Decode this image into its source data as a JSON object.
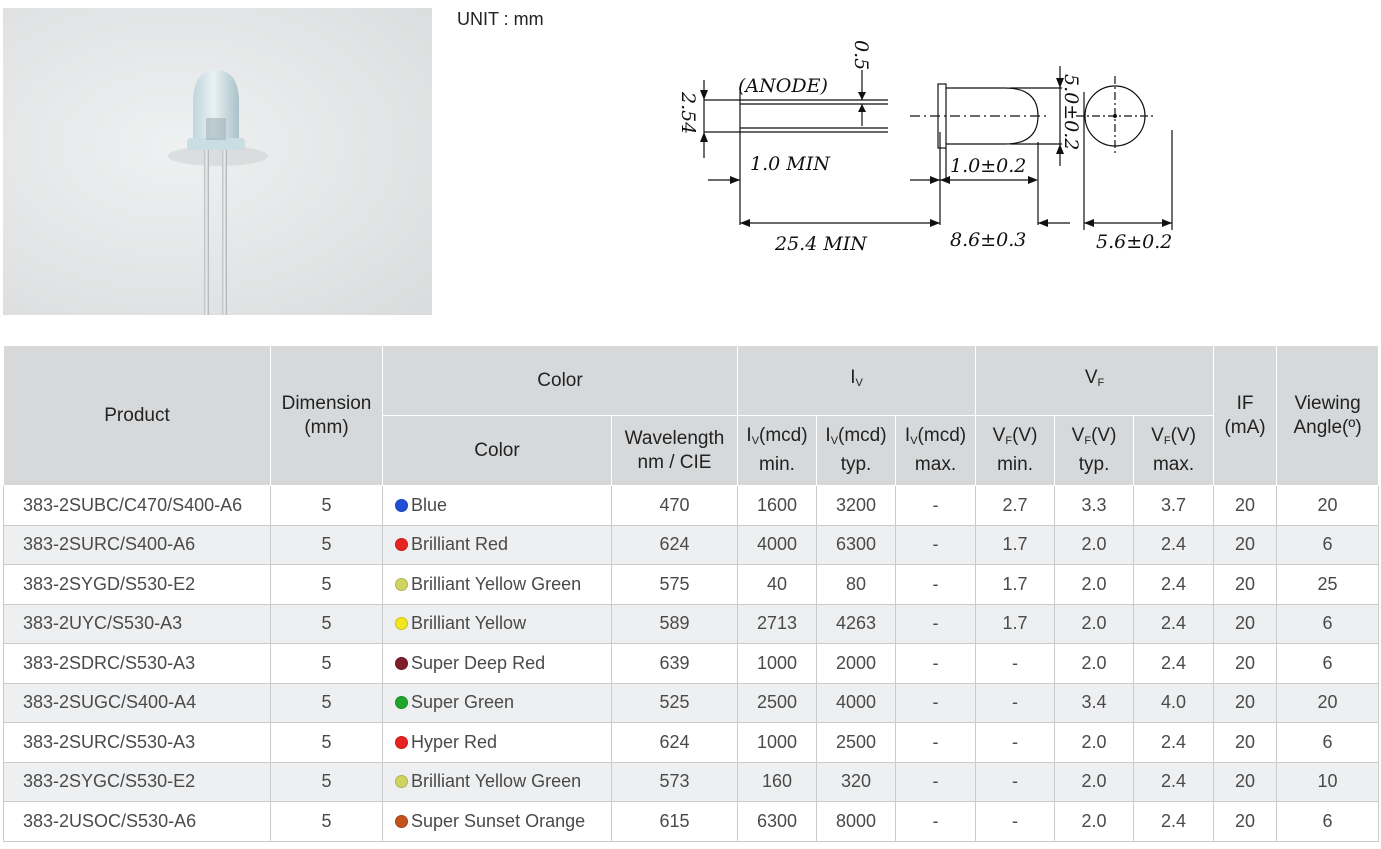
{
  "drawing": {
    "unit": "UNIT : mm",
    "anode": "(ANODE)",
    "dims": {
      "lead_thick": "0.5",
      "pitch": "2.54",
      "lead_len": "25.4  MIN",
      "flange": "1.0  MIN",
      "body_dia": "5.0±0.2",
      "stop": "1.0±0.2",
      "body_len": "8.6±0.3",
      "flange_dia": "5.6±0.2"
    }
  },
  "table": {
    "headers": {
      "product": "Product",
      "dimension": "Dimension",
      "dimension_unit": "(mm)",
      "color_group": "Color",
      "color": "Color",
      "wavelength": "Wavelength",
      "wavelength_unit": "nm / CIE",
      "iv_group": "I",
      "iv_sub": "V",
      "iv_min_a": "I",
      "iv_min_b": "V",
      "iv_min_c": "(mcd)",
      "iv_min_d": "min.",
      "iv_typ_a": "I",
      "iv_typ_b": "V",
      "iv_typ_c": "(mcd)",
      "iv_typ_d": "typ.",
      "iv_max_a": "I",
      "iv_max_b": "V",
      "iv_max_c": "(mcd)",
      "iv_max_d": "max.",
      "vf_group": "V",
      "vf_sub": "F",
      "vf_min_a": "V",
      "vf_min_b": "F",
      "vf_min_c": "(V)",
      "vf_min_d": "min.",
      "vf_typ_a": "V",
      "vf_typ_b": "F",
      "vf_typ_c": "(V)",
      "vf_typ_d": "typ.",
      "vf_max_a": "V",
      "vf_max_b": "F",
      "vf_max_c": "(V)",
      "vf_max_d": "max.",
      "if": "IF",
      "if_unit": "(mA)",
      "angle": "Viewing",
      "angle_unit": "Angle(º)"
    },
    "rows": [
      {
        "product": "383-2SUBC/C470/S400-A6",
        "dim": "5",
        "dot": "#1f4fd6",
        "color": "Blue",
        "wl": "470",
        "iv_min": "1600",
        "iv_typ": "3200",
        "iv_max": "-",
        "vf_min": "2.7",
        "vf_typ": "3.3",
        "vf_max": "3.7",
        "if": "20",
        "angle": "20"
      },
      {
        "product": "383-2SURC/S400-A6",
        "dim": "5",
        "dot": "#e8231f",
        "color": "Brilliant Red",
        "wl": "624",
        "iv_min": "4000",
        "iv_typ": "6300",
        "iv_max": "-",
        "vf_min": "1.7",
        "vf_typ": "2.0",
        "vf_max": "2.4",
        "if": "20",
        "angle": "6"
      },
      {
        "product": "383-2SYGD/S530-E2",
        "dim": "5",
        "dot": "#cfd35f",
        "color": "Brilliant Yellow Green",
        "wl": "575",
        "iv_min": "40",
        "iv_typ": "80",
        "iv_max": "-",
        "vf_min": "1.7",
        "vf_typ": "2.0",
        "vf_max": "2.4",
        "if": "20",
        "angle": "25"
      },
      {
        "product": "383-2UYC/S530-A3",
        "dim": "5",
        "dot": "#f2e61c",
        "color": "Brilliant Yellow",
        "wl": "589",
        "iv_min": "2713",
        "iv_typ": "4263",
        "iv_max": "-",
        "vf_min": "1.7",
        "vf_typ": "2.0",
        "vf_max": "2.4",
        "if": "20",
        "angle": "6"
      },
      {
        "product": "383-2SDRC/S530-A3",
        "dim": "5",
        "dot": "#7d1f2a",
        "color": "Super Deep Red",
        "wl": "639",
        "iv_min": "1000",
        "iv_typ": "2000",
        "iv_max": "-",
        "vf_min": "-",
        "vf_typ": "2.0",
        "vf_max": "2.4",
        "if": "20",
        "angle": "6"
      },
      {
        "product": "383-2SUGC/S400-A4",
        "dim": "5",
        "dot": "#1fa52b",
        "color": "Super Green",
        "wl": "525",
        "iv_min": "2500",
        "iv_typ": "4000",
        "iv_max": "-",
        "vf_min": "-",
        "vf_typ": "3.4",
        "vf_max": "4.0",
        "if": "20",
        "angle": "20"
      },
      {
        "product": "383-2SURC/S530-A3",
        "dim": "5",
        "dot": "#e8231f",
        "color": "Hyper Red",
        "wl": "624",
        "iv_min": "1000",
        "iv_typ": "2500",
        "iv_max": "-",
        "vf_min": "-",
        "vf_typ": "2.0",
        "vf_max": "2.4",
        "if": "20",
        "angle": "6"
      },
      {
        "product": "383-2SYGC/S530-E2",
        "dim": "5",
        "dot": "#cfd35f",
        "color": "Brilliant Yellow Green",
        "wl": "573",
        "iv_min": "160",
        "iv_typ": "320",
        "iv_max": "-",
        "vf_min": "-",
        "vf_typ": "2.0",
        "vf_max": "2.4",
        "if": "20",
        "angle": "10"
      },
      {
        "product": "383-2USOC/S530-A6",
        "dim": "5",
        "dot": "#c4521c",
        "color": "Super Sunset Orange",
        "wl": "615",
        "iv_min": "6300",
        "iv_typ": "8000",
        "iv_max": "-",
        "vf_min": "-",
        "vf_typ": "2.0",
        "vf_max": "2.4",
        "if": "20",
        "angle": "6"
      }
    ]
  }
}
